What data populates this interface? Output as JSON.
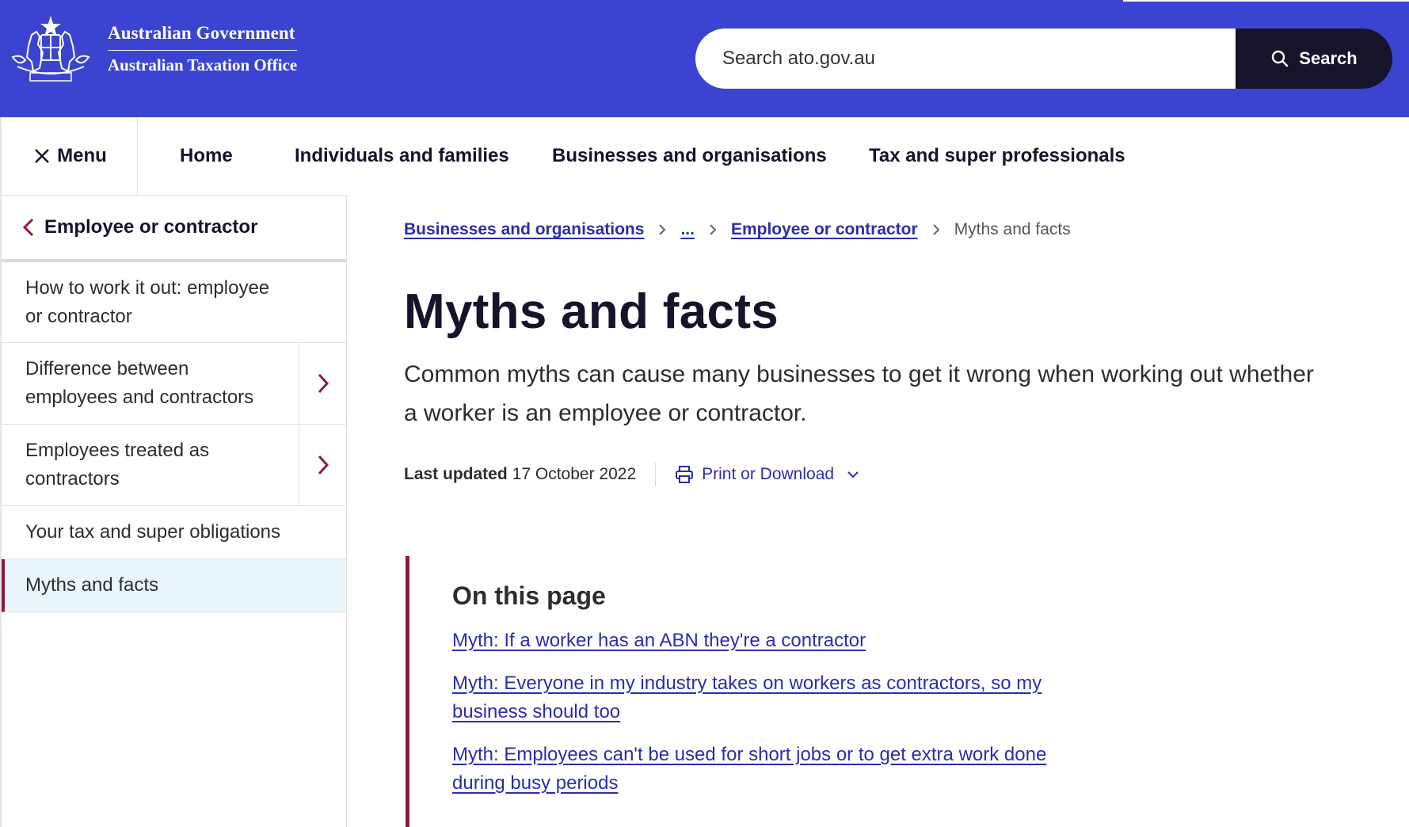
{
  "header": {
    "gov_name": "Australian Government",
    "agency_name": "Australian Taxation Office",
    "search_placeholder": "Search ato.gov.au",
    "search_button": "Search",
    "brand_color": "#3b44d0",
    "button_color": "#15142a"
  },
  "nav": {
    "menu_label": "Menu",
    "items": [
      "Home",
      "Individuals and families",
      "Businesses and organisations",
      "Tax and super professionals"
    ]
  },
  "sidebar": {
    "heading": "Employee or contractor",
    "items": [
      {
        "label": "How to work it out: employee or contractor",
        "has_children": false
      },
      {
        "label": "Difference between employees and contractors",
        "has_children": true
      },
      {
        "label": "Employees treated as contractors",
        "has_children": true
      },
      {
        "label": "Your tax and super obligations",
        "has_children": false
      },
      {
        "label": "Myths and facts",
        "has_children": false,
        "active": true
      }
    ]
  },
  "breadcrumb": {
    "items": [
      "Businesses and organisations",
      "...",
      "Employee or contractor"
    ],
    "current": "Myths and facts"
  },
  "main": {
    "title": "Myths and facts",
    "intro": "Common myths can cause many businesses to get it wrong when working out whether a worker is an employee or contractor.",
    "last_updated_label": "Last updated",
    "last_updated_date": "17 October 2022",
    "print_label": "Print or Download"
  },
  "on_this_page": {
    "heading": "On this page",
    "links": [
      "Myth: If a worker has an ABN they're a contractor",
      "Myth: Everyone in my industry takes on workers as contractors, so my business should too",
      "Myth: Employees can't be used for short jobs or to get extra work done during busy periods"
    ],
    "accent_color": "#8a1b42"
  }
}
